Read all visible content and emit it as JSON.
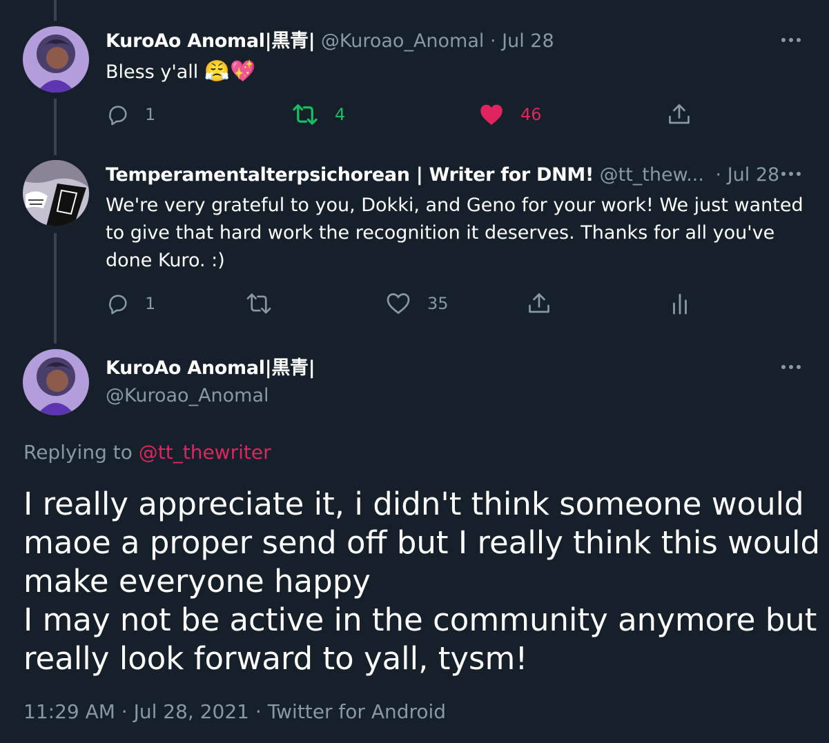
{
  "tweets": [
    {
      "display_name": "KuroAo Anomal|黒青|",
      "handle": "@Kuroao_Anomal",
      "date": "· Jul 28",
      "text": "Bless y'all",
      "emoji": "😤💖",
      "replies": "1",
      "retweets": "4",
      "likes": "46",
      "liked": true,
      "retweeted": true
    },
    {
      "display_name": "Temperamentalterpsichorean | Writer for DNM!",
      "handle": "@tt_thew...",
      "date": "· Jul 28",
      "text_lines": [
        "We're very grateful to you, Dokki, and Geno for your work! We just wanted",
        "to give that hard work the recognition it deserves. Thanks for all you've",
        "done Kuro. :)"
      ],
      "replies": "1",
      "likes": "35"
    }
  ],
  "main_tweet": {
    "display_name": "KuroAo Anomal|黒青|",
    "handle": "@Kuroao_Anomal",
    "replying_prefix": "Replying to",
    "replying_to": "@tt_thewriter",
    "text_lines": [
      "I really appreciate it, i didn't think someone would",
      "maoe a proper send off but I really think this would",
      "make everyone happy",
      "I may not be active in the community anymore but i",
      "really look forward to yall, tysm!"
    ],
    "meta": "11:29 AM · Jul 28, 2021 · Twitter for Android"
  },
  "icons": {
    "reply": "reply-icon",
    "retweet": "retweet-icon",
    "like": "heart-icon",
    "share": "share-icon",
    "analytics": "analytics-icon",
    "more": "more-icon"
  },
  "colors": {
    "background": "#15202b",
    "secondary_text": "#8899a6",
    "retweet_green": "#17bf63",
    "like_pink": "#e0245e",
    "thread_line": "#38444d"
  }
}
